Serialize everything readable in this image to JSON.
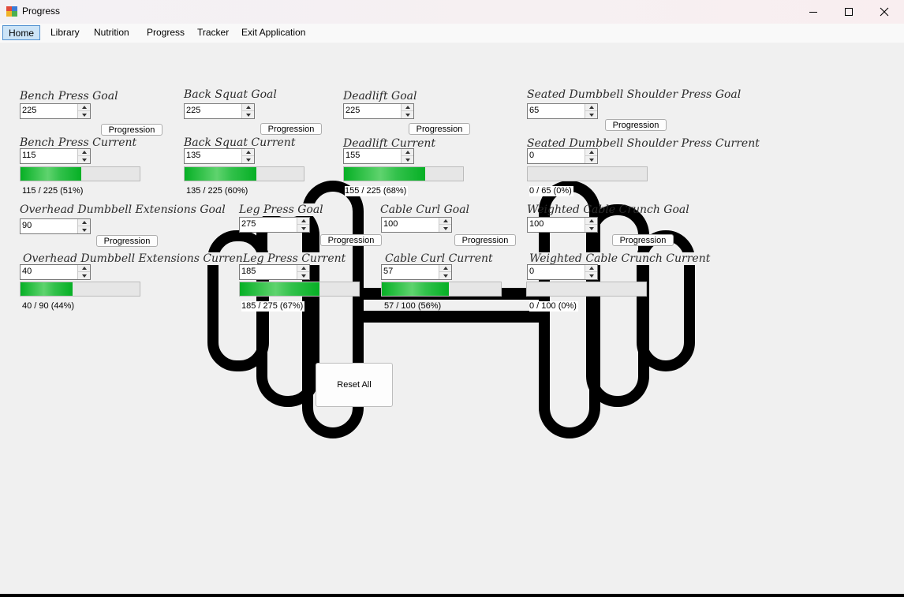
{
  "window": {
    "title": "Progress"
  },
  "menu": {
    "items": [
      "Home",
      "Library",
      "Nutrition",
      "Progress",
      "Tracker",
      "Exit Application"
    ],
    "active": "Home"
  },
  "colors": {
    "progress_fill": "#06b025",
    "menu_active_bg": "#cce4f7",
    "menu_active_border": "#4f8fd0",
    "background": "#f0f0f0"
  },
  "icons": {
    "minimize": "minimize-icon",
    "maximize": "maximize-icon",
    "close": "close-icon"
  },
  "progression_label": "Progression",
  "reset_label": "Reset All",
  "exercises": [
    {
      "goal_label": "Bench Press Goal",
      "current_label": "Bench Press Current",
      "goal": "225",
      "current": "115",
      "percent": 51,
      "progress_text": "115 / 225 (51%)"
    },
    {
      "goal_label": "Back Squat Goal",
      "current_label": "Back Squat Current",
      "goal": "225",
      "current": "135",
      "percent": 60,
      "progress_text": "135 / 225 (60%)"
    },
    {
      "goal_label": "Deadlift Goal",
      "current_label": "Deadlift Current",
      "goal": "225",
      "current": "155",
      "percent": 68,
      "progress_text": "155 / 225 (68%)"
    },
    {
      "goal_label": "Seated Dumbbell Shoulder Press Goal",
      "current_label": "Seated Dumbbell Shoulder Press Current",
      "goal": "65",
      "current": "0",
      "percent": 0,
      "progress_text": "0 / 65 (0%)"
    },
    {
      "goal_label": "Overhead Dumbbell Extensions Goal",
      "current_label": "Overhead Dumbbell Extensions Current",
      "goal": "90",
      "current": "40",
      "percent": 44,
      "progress_text": "40 / 90 (44%)"
    },
    {
      "goal_label": "Leg Press Goal",
      "current_label": "Leg Press Current",
      "goal": "275",
      "current": "185",
      "percent": 67,
      "progress_text": "185 / 275 (67%)"
    },
    {
      "goal_label": "Cable Curl Goal",
      "current_label": "Cable Curl Current",
      "goal": "100",
      "current": "57",
      "percent": 56,
      "progress_text": "57 / 100 (56%)"
    },
    {
      "goal_label": "Weighted Cable Crunch Goal",
      "current_label": "Weighted Cable Crunch Current",
      "goal": "100",
      "current": "0",
      "percent": 0,
      "progress_text": "0 / 100 (0%)"
    }
  ]
}
